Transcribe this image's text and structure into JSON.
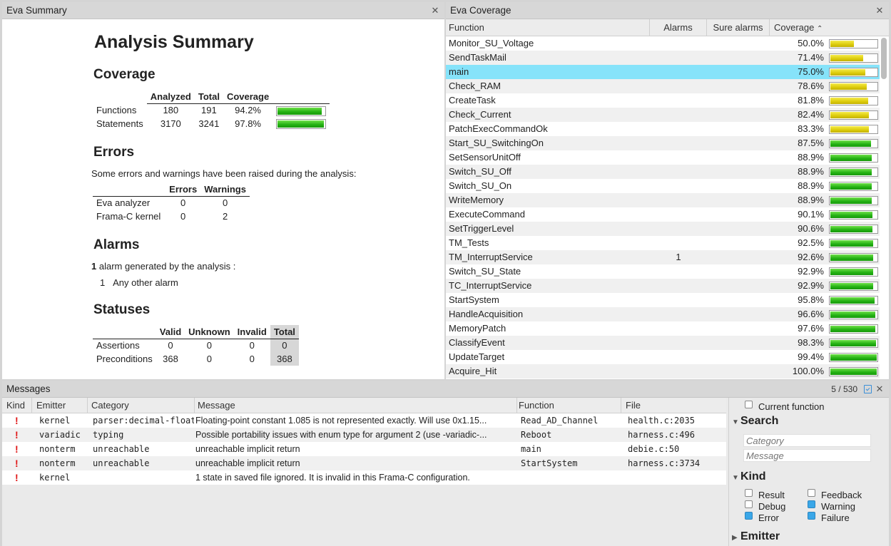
{
  "summary_panel": {
    "title": "Eva Summary",
    "heading": "Analysis Summary",
    "coverage": {
      "heading": "Coverage",
      "columns": [
        "Analyzed",
        "Total",
        "Coverage"
      ],
      "rows": [
        {
          "label": "Functions",
          "analyzed": "180",
          "total": "191",
          "coverage": "94.2%",
          "fraction": 0.942
        },
        {
          "label": "Statements",
          "analyzed": "3170",
          "total": "3241",
          "coverage": "97.8%",
          "fraction": 0.978
        }
      ]
    },
    "errors": {
      "heading": "Errors",
      "intro": "Some errors and warnings have been raised during the analysis:",
      "columns": [
        "Errors",
        "Warnings"
      ],
      "rows": [
        {
          "label": "Eva analyzer",
          "errors": "0",
          "warnings": "0"
        },
        {
          "label": "Frama-C kernel",
          "errors": "0",
          "warnings": "2"
        }
      ]
    },
    "alarms": {
      "heading": "Alarms",
      "count": "1",
      "text": " alarm generated by the analysis :",
      "item_count": "1",
      "item_label": "Any other alarm"
    },
    "statuses": {
      "heading": "Statuses",
      "columns": [
        "Valid",
        "Unknown",
        "Invalid",
        "Total"
      ],
      "rows": [
        {
          "label": "Assertions",
          "valid": "0",
          "unknown": "0",
          "invalid": "0",
          "total": "0"
        },
        {
          "label": "Preconditions",
          "valid": "368",
          "unknown": "0",
          "invalid": "0",
          "total": "368"
        }
      ]
    }
  },
  "coverage_panel": {
    "title": "Eva Coverage",
    "columns": [
      "Function",
      "Alarms",
      "Sure alarms",
      "Coverage"
    ],
    "sort_indicator": "⌃",
    "rows": [
      {
        "function": "Monitor_SU_Voltage",
        "alarms": "",
        "sure": "",
        "coverage": "50.0%",
        "fraction": 0.5,
        "color": "yellow"
      },
      {
        "function": "SendTaskMail",
        "alarms": "",
        "sure": "",
        "coverage": "71.4%",
        "fraction": 0.714,
        "color": "yellow"
      },
      {
        "function": "main",
        "alarms": "",
        "sure": "",
        "coverage": "75.0%",
        "fraction": 0.75,
        "color": "yellow"
      },
      {
        "function": "Check_RAM",
        "alarms": "",
        "sure": "",
        "coverage": "78.6%",
        "fraction": 0.786,
        "color": "yellow"
      },
      {
        "function": "CreateTask",
        "alarms": "",
        "sure": "",
        "coverage": "81.8%",
        "fraction": 0.818,
        "color": "yellow"
      },
      {
        "function": "Check_Current",
        "alarms": "",
        "sure": "",
        "coverage": "82.4%",
        "fraction": 0.824,
        "color": "yellow"
      },
      {
        "function": "PatchExecCommandOk",
        "alarms": "",
        "sure": "",
        "coverage": "83.3%",
        "fraction": 0.833,
        "color": "yellow"
      },
      {
        "function": "Start_SU_SwitchingOn",
        "alarms": "",
        "sure": "",
        "coverage": "87.5%",
        "fraction": 0.875,
        "color": "green"
      },
      {
        "function": "SetSensorUnitOff",
        "alarms": "",
        "sure": "",
        "coverage": "88.9%",
        "fraction": 0.889,
        "color": "green"
      },
      {
        "function": "Switch_SU_Off",
        "alarms": "",
        "sure": "",
        "coverage": "88.9%",
        "fraction": 0.889,
        "color": "green"
      },
      {
        "function": "Switch_SU_On",
        "alarms": "",
        "sure": "",
        "coverage": "88.9%",
        "fraction": 0.889,
        "color": "green"
      },
      {
        "function": "WriteMemory",
        "alarms": "",
        "sure": "",
        "coverage": "88.9%",
        "fraction": 0.889,
        "color": "green"
      },
      {
        "function": "ExecuteCommand",
        "alarms": "",
        "sure": "",
        "coverage": "90.1%",
        "fraction": 0.901,
        "color": "green"
      },
      {
        "function": "SetTriggerLevel",
        "alarms": "",
        "sure": "",
        "coverage": "90.6%",
        "fraction": 0.906,
        "color": "green"
      },
      {
        "function": "TM_Tests",
        "alarms": "",
        "sure": "",
        "coverage": "92.5%",
        "fraction": 0.925,
        "color": "green"
      },
      {
        "function": "TM_InterruptService",
        "alarms": "1",
        "sure": "",
        "coverage": "92.6%",
        "fraction": 0.926,
        "color": "green"
      },
      {
        "function": "Switch_SU_State",
        "alarms": "",
        "sure": "",
        "coverage": "92.9%",
        "fraction": 0.929,
        "color": "green"
      },
      {
        "function": "TC_InterruptService",
        "alarms": "",
        "sure": "",
        "coverage": "92.9%",
        "fraction": 0.929,
        "color": "green"
      },
      {
        "function": "StartSystem",
        "alarms": "",
        "sure": "",
        "coverage": "95.8%",
        "fraction": 0.958,
        "color": "green"
      },
      {
        "function": "HandleAcquisition",
        "alarms": "",
        "sure": "",
        "coverage": "96.6%",
        "fraction": 0.966,
        "color": "green"
      },
      {
        "function": "MemoryPatch",
        "alarms": "",
        "sure": "",
        "coverage": "97.6%",
        "fraction": 0.976,
        "color": "green"
      },
      {
        "function": "ClassifyEvent",
        "alarms": "",
        "sure": "",
        "coverage": "98.3%",
        "fraction": 0.983,
        "color": "green"
      },
      {
        "function": "UpdateTarget",
        "alarms": "",
        "sure": "",
        "coverage": "99.4%",
        "fraction": 0.994,
        "color": "green"
      },
      {
        "function": "Acquire_Hit",
        "alarms": "",
        "sure": "",
        "coverage": "100.0%",
        "fraction": 1.0,
        "color": "green"
      }
    ],
    "selected_index": 2
  },
  "messages_panel": {
    "title": "Messages",
    "count": "5 / 530",
    "columns": [
      "Kind",
      "Emitter",
      "Category",
      "Message",
      "Function",
      "File"
    ],
    "rows": [
      {
        "kind": "!",
        "emitter": "kernel",
        "category": "parser:decimal-float",
        "message": "Floating-point constant 1.085 is not represented exactly. Will use 0x1.15...",
        "function": "Read_AD_Channel",
        "file": "health.c:2035"
      },
      {
        "kind": "!",
        "emitter": "variadic",
        "category": "typing",
        "message": "Possible portability issues with enum type for argument 2 (use -variadic-...",
        "function": "Reboot",
        "file": "harness.c:496"
      },
      {
        "kind": "!",
        "emitter": "nonterm",
        "category": "unreachable",
        "message": "unreachable implicit return",
        "function": "main",
        "file": "debie.c:50"
      },
      {
        "kind": "!",
        "emitter": "nonterm",
        "category": "unreachable",
        "message": "unreachable implicit return",
        "function": "StartSystem",
        "file": "harness.c:3734"
      },
      {
        "kind": "!",
        "emitter": "kernel",
        "category": "",
        "message": "1 state in saved file ignored. It is invalid in this Frama-C configuration.",
        "function": "",
        "file": ""
      }
    ]
  },
  "filters": {
    "current_function_label": "Current function",
    "current_function_checked": false,
    "search_heading": "Search",
    "category_placeholder": "Category",
    "message_placeholder": "Message",
    "kind_heading": "Kind",
    "kinds": [
      {
        "label": "Result",
        "checked": false
      },
      {
        "label": "Feedback",
        "checked": false
      },
      {
        "label": "Debug",
        "checked": false
      },
      {
        "label": "Warning",
        "checked": true
      },
      {
        "label": "Error",
        "checked": true
      },
      {
        "label": "Failure",
        "checked": true
      }
    ],
    "emitter_heading": "Emitter"
  },
  "colors": {
    "selected_row": "#86e3fa",
    "bar_green": "#22b012",
    "bar_yellow": "#dccb0a",
    "error_mark": "#e01818",
    "checkbox_on": "#3aa7e8"
  }
}
